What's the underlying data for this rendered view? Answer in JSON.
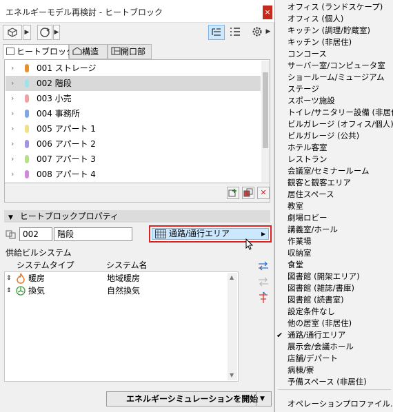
{
  "window": {
    "title": "エネルギーモデル再検討 - ヒートブロック",
    "close": "×"
  },
  "tabs": [
    {
      "label": "ヒートブロック",
      "icon": "heat-block-icon"
    },
    {
      "label": "構造",
      "icon": "structure-icon"
    },
    {
      "label": "開口部",
      "icon": "opening-icon"
    }
  ],
  "blocks": [
    {
      "label": "001 ストレージ",
      "color": "#e8902a",
      "selected": false
    },
    {
      "label": "002 階段",
      "color": "#9fe3e8",
      "selected": true
    },
    {
      "label": "003 小売",
      "color": "#f0a3a3",
      "selected": false
    },
    {
      "label": "004 事務所",
      "color": "#7fa7e0",
      "selected": false
    },
    {
      "label": "005 アパート 1",
      "color": "#f0e08a",
      "selected": false
    },
    {
      "label": "006 アパート 2",
      "color": "#a393e0",
      "selected": false
    },
    {
      "label": "007 アパート 3",
      "color": "#b8e08a",
      "selected": false
    },
    {
      "label": "008 アパート 4",
      "color": "#d08ad8",
      "selected": false
    }
  ],
  "properties": {
    "header": "ヒートブロックプロパティ",
    "id": "002",
    "name": "階段",
    "zone_selected": "通路/通行エリア"
  },
  "systems": {
    "title": "供給ビルシステム",
    "col_type": "システムタイプ",
    "col_name": "システム名",
    "rows": [
      {
        "type": "暖房",
        "name": "地域暖房",
        "icon": "flame-icon"
      },
      {
        "type": "換気",
        "name": "自然換気",
        "icon": "fan-icon"
      }
    ]
  },
  "simulate_button": "エネルギーシミュレーションを開始",
  "menu": {
    "items": [
      "オフィス (ランドスケープ)",
      "オフィス (個人)",
      "キッチン (調理/貯蔵室)",
      "キッチン (非居住)",
      "コンコース",
      "サーバー室/コンピュータ室",
      "ショールーム/ミュージアム",
      "ステージ",
      "スポーツ施設",
      "トイレ/サニタリー設備 (非居住)",
      "ビルガレージ (オフィス/個人)",
      "ビルガレージ (公共)",
      "ホテル客室",
      "レストラン",
      "会議室/セミナールーム",
      "観客と観客エリア",
      "居住スペース",
      "教室",
      "劇場ロビー",
      "講義室/ホール",
      "作業場",
      "収納室",
      "食堂",
      "図書館 (開架エリア)",
      "図書館 (雑誌/書庫)",
      "図書館 (読書室)",
      "設定条件なし",
      "他の居室 (非居住)",
      "通路/通行エリア",
      "展示会/会議ホール",
      "店舗/デパート",
      "病棟/寮",
      "予備スペース (非居住)"
    ],
    "checked_index": 28,
    "checkmark": "✔",
    "footer": "オペレーションプロファイル..."
  }
}
